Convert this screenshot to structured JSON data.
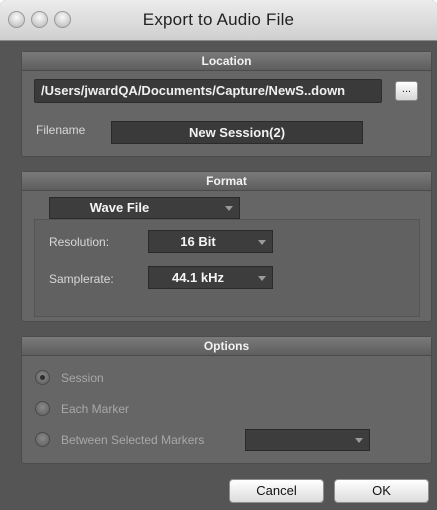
{
  "window": {
    "title": "Export to Audio File"
  },
  "location": {
    "header": "Location",
    "path": "/Users/jwardQA/Documents/Capture/NewS..down",
    "browse_label": "...",
    "filename_label": "Filename",
    "filename_value": "New Session(2)"
  },
  "format": {
    "header": "Format",
    "file_type": "Wave File",
    "resolution_label": "Resolution:",
    "resolution_value": "16 Bit",
    "samplerate_label": "Samplerate:",
    "samplerate_value": "44.1 kHz"
  },
  "options": {
    "header": "Options",
    "radios": [
      {
        "label": "Session",
        "selected": true
      },
      {
        "label": "Each Marker",
        "selected": false
      },
      {
        "label": "Between Selected Markers",
        "selected": false
      }
    ],
    "marker_select_value": ""
  },
  "buttons": {
    "cancel": "Cancel",
    "ok": "OK"
  }
}
